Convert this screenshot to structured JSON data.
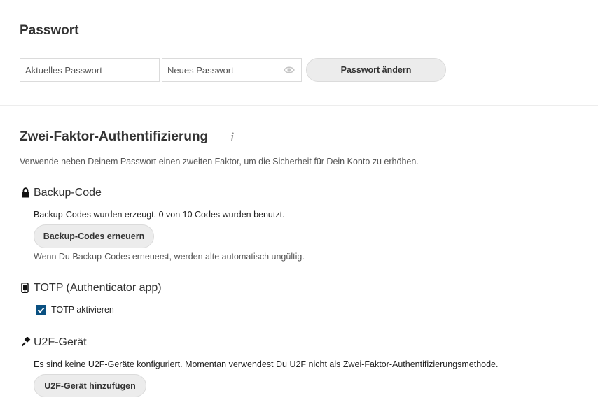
{
  "password": {
    "heading": "Passwort",
    "current_placeholder": "Aktuelles Passwort",
    "new_placeholder": "Neues Passwort",
    "change_button": "Passwort ändern"
  },
  "two_factor": {
    "heading": "Zwei-Faktor-Authentifizierung",
    "info_icon": "i",
    "description": "Verwende neben Deinem Passwort einen zweiten Faktor, um die Sicherheit für Dein Konto zu erhöhen.",
    "backup": {
      "heading": "Backup-Code",
      "status": "Backup-Codes wurden erzeugt. 0 von 10 Codes wurden benutzt.",
      "regenerate_button": "Backup-Codes erneuern",
      "hint": "Wenn Du Backup-Codes erneuerst, werden alte automatisch ungültig."
    },
    "totp": {
      "heading": "TOTP (Authenticator app)",
      "checkbox_label": "TOTP aktivieren",
      "enabled": true
    },
    "u2f": {
      "heading": "U2F-Gerät",
      "status": "Es sind keine U2F-Geräte konfiguriert. Momentan verwendest Du U2F nicht als Zwei-Faktor-Authentifizierungsmethode.",
      "add_button": "U2F-Gerät hinzufügen"
    }
  },
  "icons": {
    "lock": "lock-icon",
    "phone": "phone-icon",
    "usb": "usb-icon",
    "eye": "eye-icon",
    "info": "info-icon",
    "check": "checkmark-icon"
  },
  "colors": {
    "checkbox": "#0a5081",
    "button_bg": "#ececec",
    "border": "#dbdbdb"
  }
}
